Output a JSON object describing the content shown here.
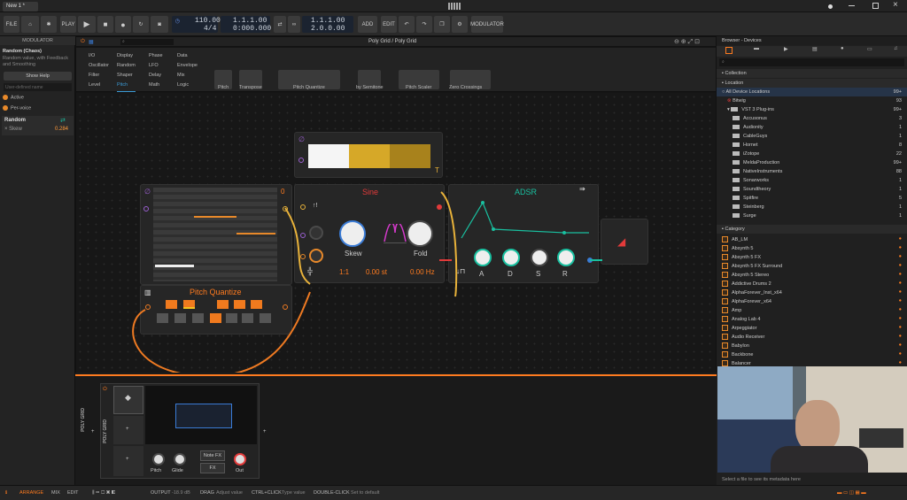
{
  "window": {
    "tab": "New 1 *"
  },
  "toolbar": {
    "file": "FILE",
    "play": "PLAY",
    "add": "ADD",
    "edit": "EDIT",
    "modulator": "MODULATOR",
    "tempo": "110.00",
    "signature": "4/4",
    "position": "1.1.1.00",
    "time": "0:000.000",
    "loop_start": "1.1.1.00",
    "loop_end": "2.0.0.00"
  },
  "inspector": {
    "header": "MODULATOR",
    "device_name": "Random (Chaos)",
    "device_desc": "Random value, with Feedback and Smoothing",
    "show_help": "Show Help",
    "user_name_placeholder": "User-defined name",
    "active": "Active",
    "per_voice": "Per-voice",
    "mod_name": "Random",
    "param": "Skew",
    "param_value": "0.284"
  },
  "grid": {
    "title": "Poly Grid / Poly Grid",
    "palette_cols": [
      [
        "I/O",
        "Oscillator",
        "Filter",
        "Level"
      ],
      [
        "Display",
        "Random",
        "Shaper",
        "Pitch"
      ],
      [
        "Phase",
        "LFO",
        "Delay",
        "Math"
      ],
      [
        "Data",
        "Envelope",
        "Mix",
        "Logic"
      ]
    ],
    "modules": [
      "Pitch",
      "Transpose",
      "Pitch Quantize",
      "by Semitone",
      "Pitch Scaler",
      "Zero Crossings"
    ]
  },
  "nodes": {
    "seq_value": "0",
    "trigger_letter": "T",
    "sine_title": "Sine",
    "skew": "Skew",
    "fold": "Fold",
    "ratio": "1:1",
    "semitones": "0.00 st",
    "hz": "0.00 Hz",
    "adsr_title": "ADSR",
    "a": "A",
    "d": "D",
    "s": "S",
    "r": "R",
    "pq_title": "Pitch Quantize"
  },
  "browser": {
    "title": "Browser - Devices",
    "collection": "Collection",
    "location": "Location",
    "all": "All Device Locations",
    "all_count": "99+",
    "bitwig": "Bitwig",
    "bitwig_count": "93",
    "vst3": "VST 3 Plug-ins",
    "vst3_count": "99+",
    "vendors": [
      {
        "name": "Accusonus",
        "count": "3"
      },
      {
        "name": "Audionity",
        "count": "1"
      },
      {
        "name": "CableGuys",
        "count": "1"
      },
      {
        "name": "Hornet",
        "count": "8"
      },
      {
        "name": "iZotope",
        "count": "22"
      },
      {
        "name": "MeldaProduction",
        "count": "99+"
      },
      {
        "name": "NativeInstruments",
        "count": "88"
      },
      {
        "name": "Sonarworks",
        "count": "1"
      },
      {
        "name": "Soundtheory",
        "count": "1"
      },
      {
        "name": "Spitfire",
        "count": "5"
      },
      {
        "name": "Steinberg",
        "count": "1"
      },
      {
        "name": "Surge",
        "count": "1"
      }
    ],
    "category": "Category",
    "plugins": [
      "AB_LM",
      "Absynth 5",
      "Absynth 5 FX",
      "Absynth 5 FX Surround",
      "Absynth 5 Stereo",
      "Addictive Drums 2",
      "AlphaForever_Inst_x64",
      "AlphaForever_x64",
      "Amp",
      "Analog Lab 4",
      "Arpeggiator",
      "Audio Receiver",
      "Babylon",
      "Backbone",
      "Balancer"
    ],
    "footer": "Select a file to see its metadata here"
  },
  "device": {
    "track": "POLY GRID",
    "inner": "POLY GRID",
    "pitch": "Pitch",
    "glide": "Glide",
    "note_fx": "Note FX",
    "fx": "FX",
    "out": "Out"
  },
  "status": {
    "arrange": "ARRANGE",
    "mix": "MIX",
    "edit": "EDIT",
    "output": "OUTPUT",
    "output_val": "-18.9 dB",
    "drag": "DRAG",
    "drag_hint": "Adjust value",
    "ctrl": "CTRL+CLICK",
    "ctrl_hint": "Type value",
    "dbl": "DOUBLE-CLICK",
    "dbl_hint": "Set to default"
  },
  "colors": {
    "accent": "#ff7b1f",
    "sine": "#e23a3a",
    "adsr": "#19c0a0",
    "cable_yellow": "#e8b23a",
    "cable_orange": "#ee7a22",
    "purple": "#9a5fd0",
    "blue": "#3a7bd5"
  }
}
